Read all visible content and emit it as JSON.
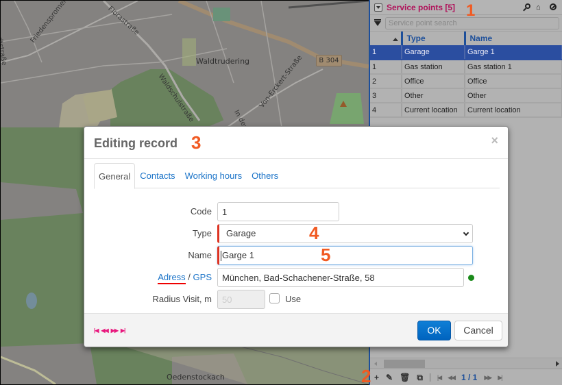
{
  "map": {
    "labels": {
      "friedenspromenade": "Friedenspromenade",
      "florastrasse": "Florastraße",
      "waldtrudering": "Waldtrudering",
      "waldschulstrasse": "Waldschulstraße",
      "von_erckert": "Von-Erckert-Straße",
      "in_der_he": "In der He",
      "stadtstrasse": "...dtstraße",
      "oedenstockach": "Oedenstockach",
      "road_shield": "B 304"
    }
  },
  "panel": {
    "title": "Service points [5]",
    "annotation": "1",
    "icons": [
      "search-icon",
      "home-icon",
      "clear-icon"
    ],
    "search": {
      "placeholder": "Service point search",
      "value": ""
    },
    "columns": {
      "idx": "",
      "type": "Type",
      "name": "Name"
    },
    "rows": [
      {
        "code": "1",
        "type": "Garage",
        "name": "Garge 1",
        "selected": true
      },
      {
        "code": "1",
        "type": "Gas station",
        "name": "Gas station 1",
        "selected": false
      },
      {
        "code": "2",
        "type": "Office",
        "name": "Office",
        "selected": false
      },
      {
        "code": "3",
        "type": "Other",
        "name": "Other",
        "selected": false
      },
      {
        "code": "4",
        "type": "Current location",
        "name": "Current location",
        "selected": false
      }
    ],
    "pager": {
      "annotation": "2",
      "add": "+",
      "page_indicator": "1 / 1"
    }
  },
  "dialog": {
    "title": "Editing record",
    "annotation": "3",
    "close": "×",
    "tabs": [
      "General",
      "Contacts",
      "Working hours",
      "Others"
    ],
    "active_tab": "General",
    "fields": {
      "code": {
        "label": "Code",
        "value": "1"
      },
      "type": {
        "label": "Type",
        "value": "Garage",
        "annotation": "4"
      },
      "name": {
        "label": "Name",
        "value": "Garge 1",
        "annotation": "5"
      },
      "address": {
        "label_link1": "Adress",
        "label_sep": " / ",
        "label_link2": "GPS",
        "value": "München, Bad-Schachener-Straße, 58",
        "status_color": "#1a8a1a"
      },
      "radius": {
        "label": "Radius Visit, m",
        "value": "50",
        "use_label": "Use",
        "use_checked": false
      }
    },
    "record_nav": {
      "first": "|◀",
      "prev": "◀◀",
      "next": "▶▶",
      "last": "▶|"
    },
    "buttons": {
      "ok": "OK",
      "cancel": "Cancel"
    }
  },
  "colors": {
    "accent_blue": "#1d4f9a",
    "title_magenta": "#b0125a",
    "annotation_orange": "#f15a22",
    "ok_button": "#0f7fd6",
    "required_marker": "#dd3322"
  }
}
